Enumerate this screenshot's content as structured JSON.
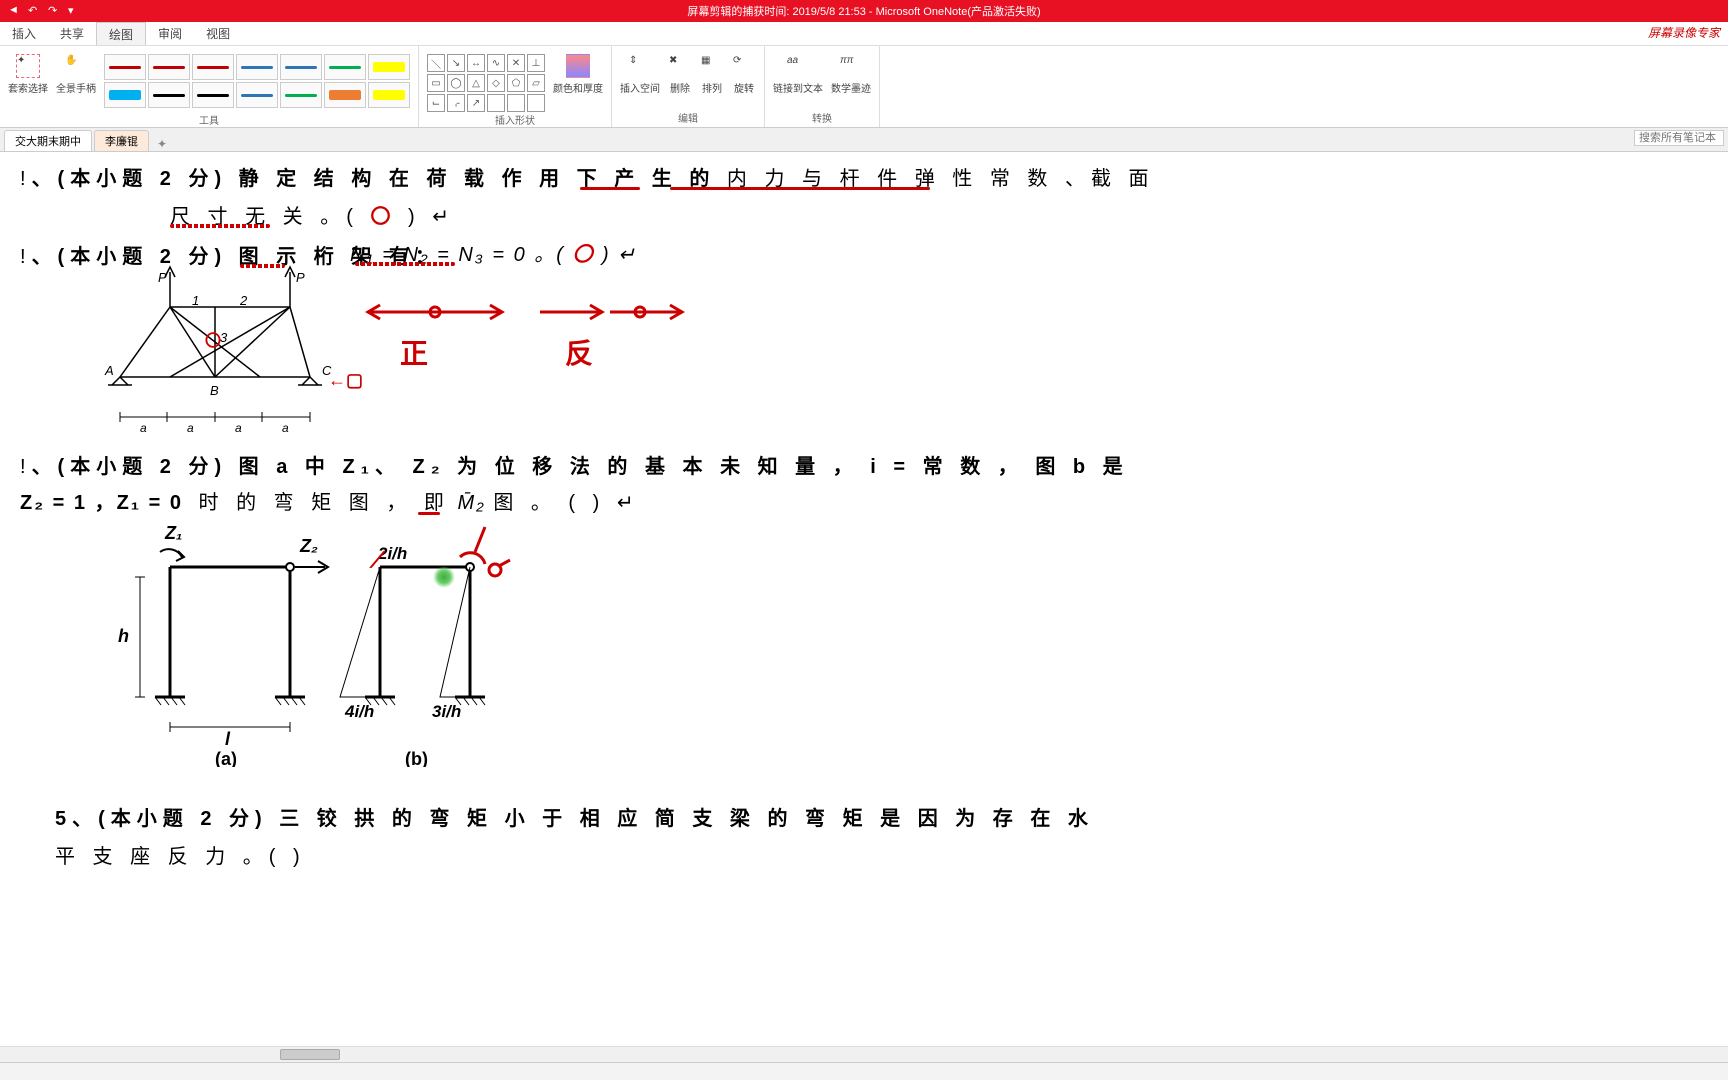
{
  "titlebar": {
    "title": "屏幕剪辑的捕获时间: 2019/5/8 21:53 - Microsoft OneNote(产品激活失败)"
  },
  "menubar": {
    "items": [
      "插入",
      "共享",
      "绘图",
      "审阅",
      "视图"
    ],
    "active_index": 2
  },
  "ribbon": {
    "group_tools": {
      "label": "工具",
      "buttons": [
        {
          "name": "select",
          "label": "套索选择"
        },
        {
          "name": "pan",
          "label": "全景手柄"
        }
      ],
      "pens_row1": [
        "#c00000",
        "#c00000",
        "#c00000",
        "#2e75b6",
        "#2e75b6",
        "#00b050",
        "#ffff00"
      ],
      "pens_row2": [
        "#00b0f0",
        "#000000",
        "#000000",
        "#2e75b6",
        "#00b050",
        "#ed7d31",
        "#ffff00"
      ]
    },
    "group_shapes": {
      "label": "插入形状",
      "color_btn": "颜色和厚度"
    },
    "group_edit": {
      "label": "编辑",
      "buttons": [
        {
          "name": "insert-space",
          "label": "插入空间"
        },
        {
          "name": "delete",
          "label": "删除"
        },
        {
          "name": "arrange",
          "label": "排列"
        },
        {
          "name": "rotate",
          "label": "旋转"
        }
      ]
    },
    "group_convert": {
      "label": "转换",
      "buttons": [
        {
          "name": "link-text",
          "label": "链接到文本"
        },
        {
          "name": "math",
          "label": "数学墨迹"
        }
      ]
    }
  },
  "watermark": "屏幕录像专家",
  "tabs": {
    "items": [
      "交大期末期中",
      "李廉锟"
    ],
    "active_index": 1,
    "search_placeholder": "搜索所有笔记本"
  },
  "content": {
    "q1_prefix": "、(本小题 2 分) 静 定 结 构 在 荷 载 作 用 下 产 生 的",
    "q1_part_a": "内 力",
    "q1_mid": "与",
    "q1_part_b": "杆 件 弹 性 常 数 、截 面",
    "q1_line2": "尺 寸 无 关 。(",
    "q1_line2_end": ") ↵",
    "q2": "、(本小题 2 分) 图 示 桁 架 有：",
    "q2_eq": "N₁ = N₂ = N₃ = 0 。(",
    "q2_end": ") ↵",
    "ann_zheng": "正",
    "ann_fan": "反",
    "mark_circle": "〇",
    "truss_labels": {
      "P": "P",
      "A": "A",
      "B": "B",
      "C": "C",
      "a": "a",
      "n1": "1",
      "n2": "2",
      "n3": "3"
    },
    "q3_a": "、(本小题 2 分) 图  a  中 Z₁、 Z₂  为 位 移 法 的 基 本 未 知 量 ， i = 常 数 ， 图  b 是",
    "q3_b_pre": "Z₂ = 1 ，Z₁ = 0",
    "q3_b": "时 的 弯 矩 图 ， 即",
    "q3_b_m": "M̄₂",
    "q3_b_end": "图 。        (        )  ↵",
    "fig_a": {
      "Z1": "Z₁",
      "Z2": "Z₂",
      "h": "h",
      "l": "l",
      "label": "(a)"
    },
    "fig_b": {
      "v1": "2i/h",
      "v2": "4i/h",
      "v3": "3i/h",
      "label": "(b)"
    },
    "q5": "5、(本小题 2 分)  三 铰 拱 的 弯 矩 小 于 相 应 简 支 梁 的 弯 矩 是 因 为 存 在 水",
    "q5b": "平 支 座 反 力 。(        )"
  }
}
